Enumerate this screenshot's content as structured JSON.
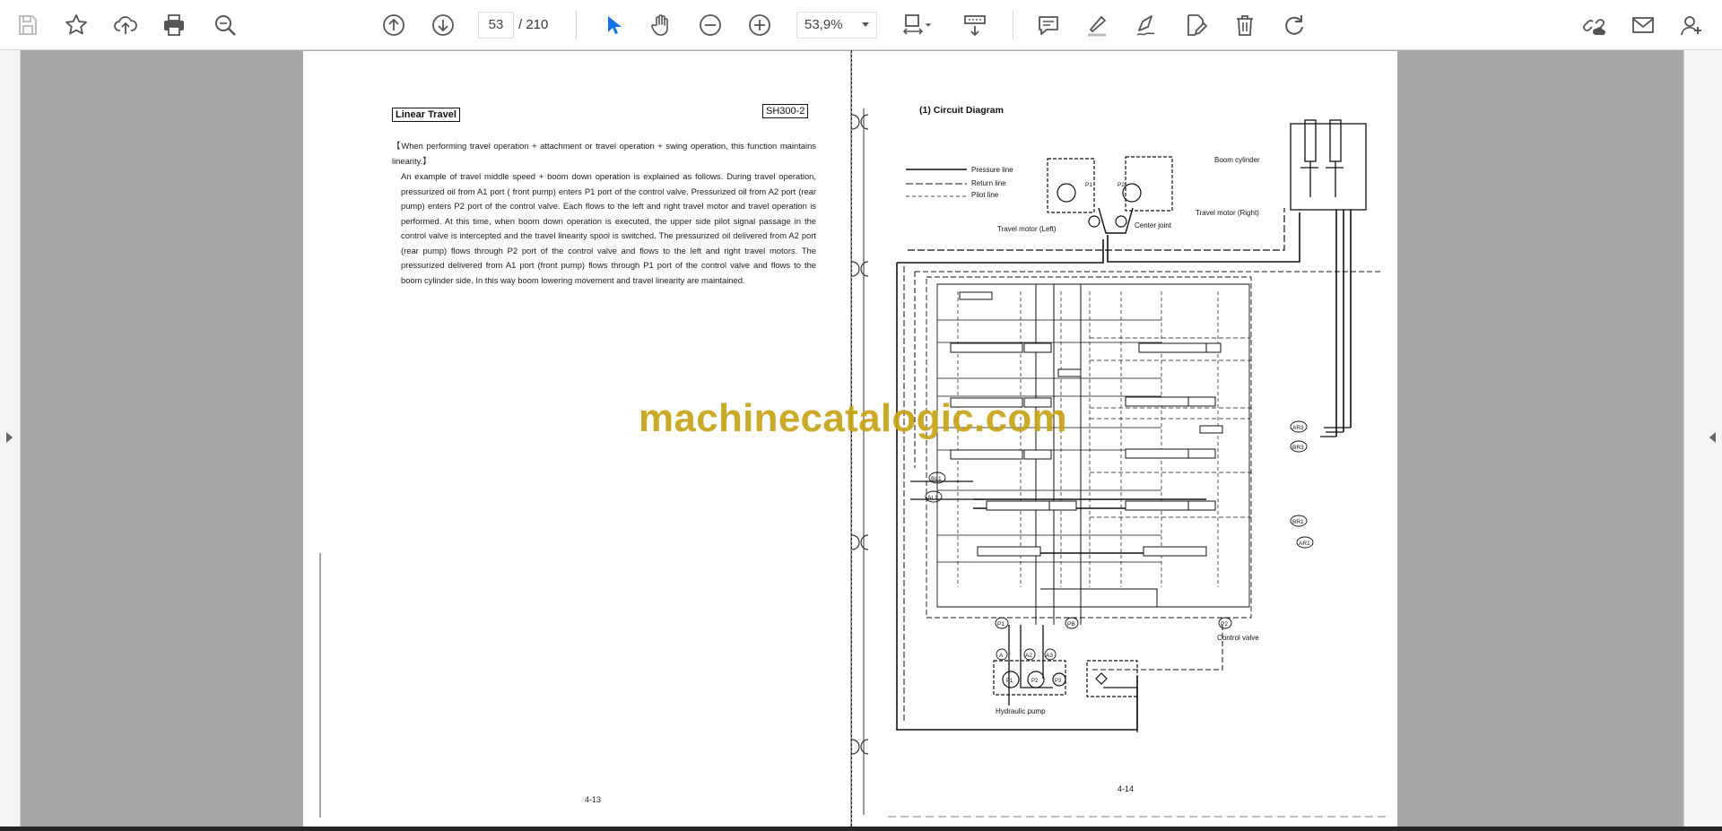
{
  "toolbar": {
    "current_page": "53",
    "total_pages": "/  210",
    "zoom": "53,9%",
    "icons": {
      "save": "save-icon",
      "bookmark": "star-icon",
      "upload": "cloud-upload-icon",
      "print": "printer-icon",
      "find": "search-zoom-icon",
      "prev_page": "arrow-up-circle-icon",
      "next_page": "arrow-down-circle-icon",
      "select": "cursor-arrow-icon",
      "hand": "hand-icon",
      "zoom_out": "minus-circle-icon",
      "zoom_in": "plus-circle-icon",
      "fit": "fit-page-icon",
      "scroll_mode": "scroll-mode-icon",
      "comment": "comment-icon",
      "highlight": "highlighter-icon",
      "sign": "pen-sign-icon",
      "edit": "edit-document-icon",
      "delete": "trash-icon",
      "rotate": "rotate-icon",
      "link": "link-cloud-icon",
      "mail": "mail-icon",
      "account": "user-add-icon"
    },
    "accent_color": "#1473e6"
  },
  "left_page": {
    "section_title": "Linear Travel",
    "model": "SH300-2",
    "intro": "【When performing travel operation + attachment or travel operation + swing operation, this function maintains linearity.】",
    "body": "An example of travel middle speed + boom down operation is explained as follows. During travel operation, pressurized oil from A1 port ( front pump) enters P1 port of the control valve. Pressurized oil from A2 port (rear pump) enters P2 port of the control valve. Each flows to the left and right travel motor and travel operation is performed. At this time, when boom down operation is executed, the upper side pilot signal passage in the control valve is intercepted and the travel linearity spool is switched. The pressurized oil delivered from A2 port (rear pump) flows through P2 port of the control valve and flows to the left and right travel motors. The pressurized delivered from A1 port (front pump) flows through P1 port of the control valve and flows to the boom cylinder side. In this way boom lowering movement and travel linearity are maintained.",
    "page_number": "4-13"
  },
  "right_page": {
    "heading": "(1)   Circuit Diagram",
    "legend": {
      "pressure": "Pressure line",
      "return": "Return line",
      "pilot": "Pilot line"
    },
    "labels": {
      "boom_cylinder": "Boom cylinder",
      "travel_motor_right": "Travel motor (Right)",
      "travel_motor_left": "Travel motor (Left)",
      "center_joint": "Center joint",
      "control_valve": "Control valve",
      "hydraulic_pump": "Hydraulic pump"
    },
    "ports": {
      "bl1": "BL1",
      "al1": "AL1",
      "ar3": "AR3",
      "br3": "BR3",
      "br1": "BR1",
      "ar1": "AR1",
      "p1": "P1",
      "p2": "P2",
      "pb": "PB",
      "a": "A",
      "a2": "A2",
      "a3": "A3",
      "pump_p1": "P1",
      "pump_p2": "P2",
      "pump_p3": "P3",
      "tm_p1": "P1",
      "tm_p2": "P2"
    },
    "page_number": "4-14"
  },
  "watermark": "machinecatalogic.com"
}
